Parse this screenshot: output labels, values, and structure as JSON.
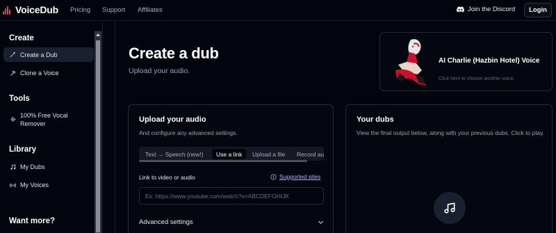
{
  "app": {
    "name": "VoiceDub"
  },
  "nav": {
    "links": [
      "Pricing",
      "Support",
      "Affiliates"
    ],
    "discord_label": "Join the Discord",
    "login_label": "Login"
  },
  "sidebar": {
    "sections": [
      {
        "heading": "Create",
        "items": [
          {
            "label": "Create a Dub",
            "icon": "wand-icon",
            "active": true
          },
          {
            "label": "Clone a Voice",
            "icon": "hammer-icon"
          }
        ]
      },
      {
        "heading": "Tools",
        "items": [
          {
            "label": "100% Free Vocal Remover",
            "label_lines": [
              "100% Free Vocal",
              "Remover"
            ],
            "icon": "waveform-icon"
          }
        ]
      },
      {
        "heading": "Library",
        "items": [
          {
            "label": "My Dubs",
            "icon": "music-note-icon"
          },
          {
            "label": "My Voices",
            "icon": "radio-waves-icon"
          }
        ]
      },
      {
        "heading": "Want more?",
        "items": []
      }
    ]
  },
  "main": {
    "title": "Create a dub",
    "subtitle": "Upload your audio."
  },
  "voice_card": {
    "name": "AI Charlie (Hazbin Hotel) Voice",
    "hint": "Click here to choose another voice."
  },
  "upload": {
    "title": "Upload your audio",
    "description": "And configure any advanced settings.",
    "tabs": [
      "Text → Speech (new!)",
      "Use a link",
      "Upload a file",
      "Record au"
    ],
    "active_tab": "Use a link",
    "link_label": "Link to video or audio",
    "supported_label": "Supported sites",
    "url_placeholder": "Ex: https://www.youtube.com/watch?v=ABCDEFGHIJK",
    "url_value": "",
    "advanced_label": "Advanced settings"
  },
  "dubs": {
    "title": "Your dubs",
    "description": "View the final output below, along with your previous dubs. Click to play."
  },
  "colors": {
    "accent": "#ff3b6b",
    "link": "#aab3ff",
    "background": "#03050d"
  }
}
